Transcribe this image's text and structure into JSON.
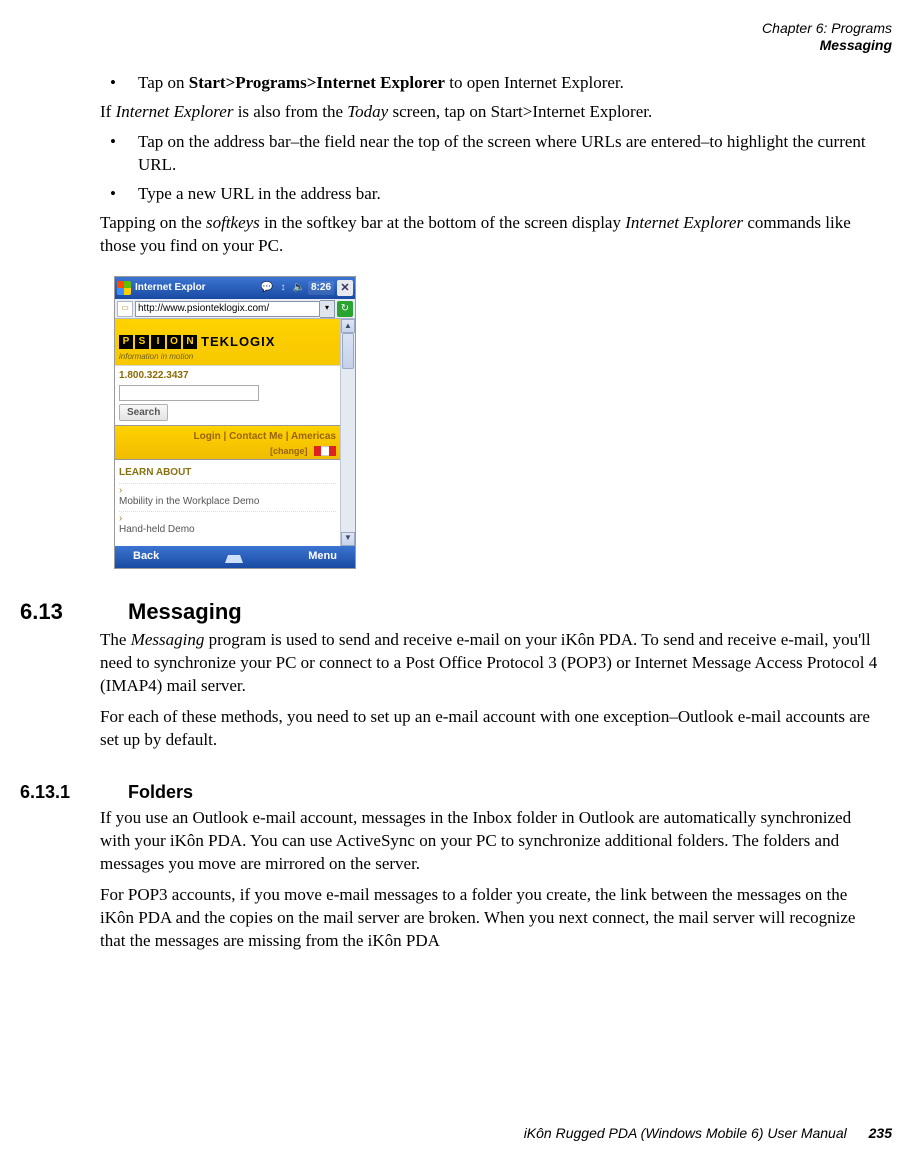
{
  "header": {
    "line1": "Chapter 6: Programs",
    "line2": "Messaging"
  },
  "body": {
    "bullet1_pre": "Tap on ",
    "bullet1_bold": "Start>Programs>Internet Explorer",
    "bullet1_post": " to open Internet Explorer.",
    "para1_a": "If ",
    "para1_it1": "Internet Explorer",
    "para1_b": " is also from the ",
    "para1_it2": "Today",
    "para1_c": " screen, tap on Start>Internet Explorer.",
    "bullet2": "Tap on the address bar–the field near the top of the screen where URLs are entered–to highlight the current URL.",
    "bullet3": "Type a new URL in the address bar.",
    "para2_a": "Tapping on the ",
    "para2_it1": "softkeys",
    "para2_b": " in the softkey bar at the bottom of the screen display ",
    "para2_it2": "Internet Explorer",
    "para2_c": " commands like those you find on your PC."
  },
  "sec613": {
    "num": "6.13",
    "title": "Messaging",
    "p1_a": "The ",
    "p1_it": "Messaging",
    "p1_b": " program is used to send and receive e-mail on your iKôn PDA. To send and receive e-mail, you'll need to synchronize your PC or connect to a Post Office Protocol 3 (POP3) or Internet Message Access Protocol 4 (IMAP4) mail server.",
    "p2": "For each of these methods, you need to set up an e-mail account with one exception–Outlook e-mail accounts are set up by default."
  },
  "sec6131": {
    "num": "6.13.1",
    "title": "Folders",
    "p1": "If you use an Outlook e-mail account, messages in the Inbox folder in Outlook are automatically synchronized with your iKôn PDA. You can use ActiveSync on your PC to synchronize additional folders. The folders and messages you move are mirrored on the server.",
    "p2": "For POP3 accounts, if you move e-mail messages to a folder you create, the link between the messages on the iKôn PDA and the copies on the mail server are broken. When you next connect, the mail server will recognize that the messages are missing from the iKôn PDA"
  },
  "screenshot": {
    "title": "Internet Explor",
    "clock": "8:26",
    "url": "http://www.psionteklogix.com/",
    "psion_letters": [
      "P",
      "S",
      "I",
      "O",
      "N"
    ],
    "teklogix": "TEKLOGIX",
    "tagline": "information in motion",
    "phone": "1.800.322.3437",
    "search_btn": "Search",
    "links_line1": "Login | Contact Me | Americas",
    "links_line2": "[change]",
    "learn_header": "LEARN ABOUT",
    "learn1": "Mobility in the Workplace Demo",
    "learn2": "Hand-held Demo",
    "sk_left": "Back",
    "sk_right": "Menu"
  },
  "footer": {
    "text": "iKôn Rugged PDA (Windows Mobile 6) User Manual",
    "page": "235"
  }
}
